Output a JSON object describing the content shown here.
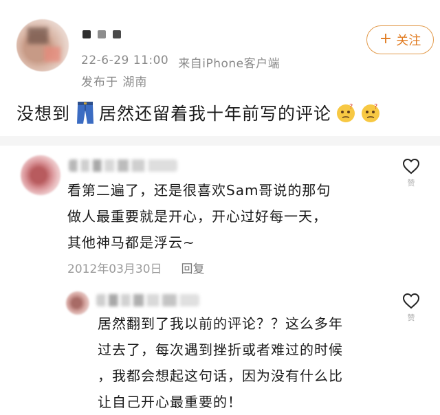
{
  "post": {
    "timestamp": "22-6-29 11:00",
    "source": "来自iPhone客户端",
    "location": "发布于 湖南",
    "follow_label": "关注",
    "text_before": "没想到",
    "text_after": "居然还留着我十年前写的评论",
    "icons": [
      "jeans-icon",
      "thinking-emoji-icon",
      "thinking-emoji-icon"
    ]
  },
  "comments": [
    {
      "lines": [
        "看第二遍了，还是很喜欢Sam哥说的那句",
        "做人最重要就是开心，开心过好每一天，",
        "其他神马都是浮云~"
      ],
      "date": "2012年03月30日",
      "reply_label": "回复",
      "like_label": "赞"
    },
    {
      "lines": [
        "居然翻到了我以前的评论？？这么多年",
        "过去了，每次遇到挫折或者难过的时候",
        "，我都会想起这句话，因为没有什么比",
        "让自己开心最重要的！"
      ],
      "like_label": "赞"
    }
  ],
  "colors": {
    "accent": "#e07a1f",
    "meta_text": "#8a8a8a",
    "divider": "#f5f5f5"
  }
}
